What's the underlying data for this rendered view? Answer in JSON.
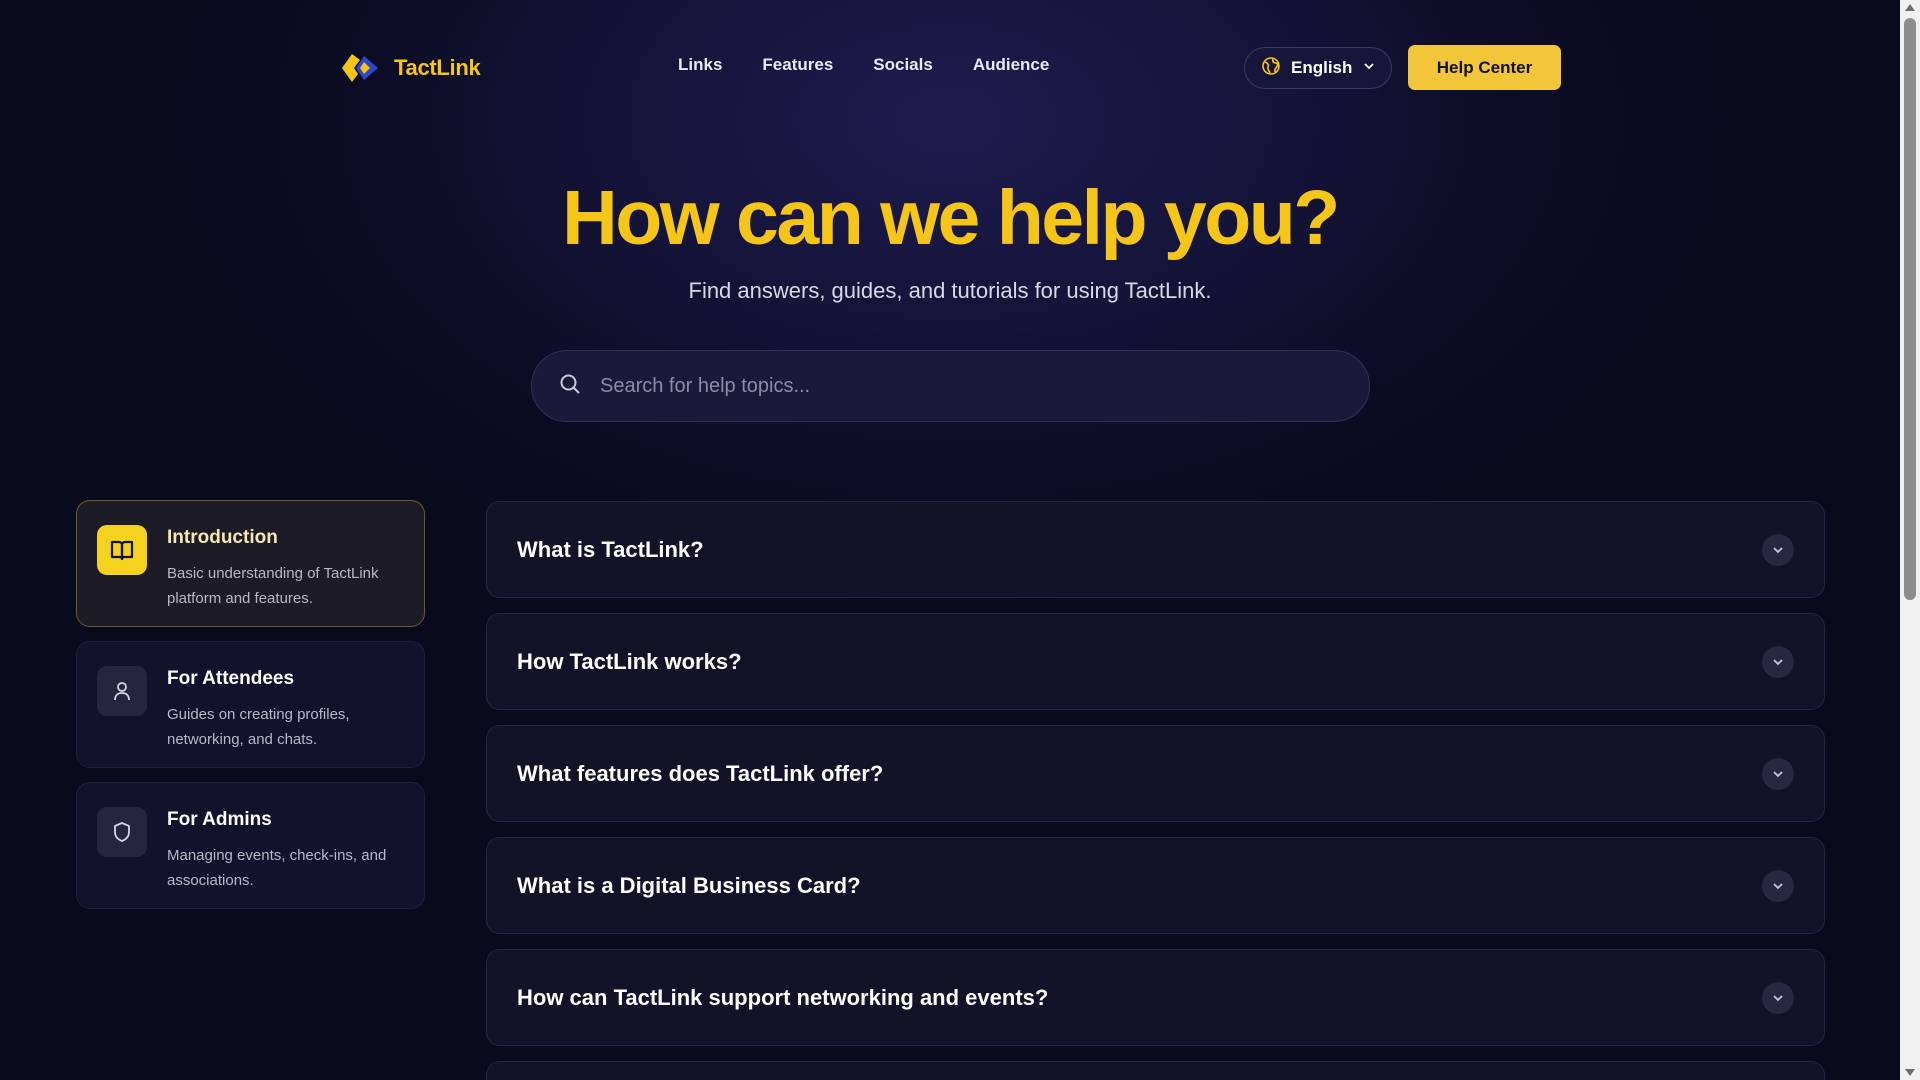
{
  "brand": {
    "name": "TactLink",
    "accent": "#f5c518"
  },
  "nav": {
    "items": [
      "Links",
      "Features",
      "Socials",
      "Audience"
    ]
  },
  "language": {
    "label": "English",
    "icon": "globe-icon"
  },
  "header": {
    "help_label": "Help Center"
  },
  "hero": {
    "title": "How can we help you?",
    "subtitle": "Find answers, guides, and tutorials for using TactLink."
  },
  "search": {
    "placeholder": "Search for help topics...",
    "value": ""
  },
  "sidebar": {
    "items": [
      {
        "title": "Introduction",
        "desc": "Basic understanding of TactLink platform and features.",
        "icon": "book-icon",
        "active": true
      },
      {
        "title": "For Attendees",
        "desc": "Guides on creating profiles, networking, and chats.",
        "icon": "user-icon",
        "active": false
      },
      {
        "title": "For Admins",
        "desc": "Managing events, check-ins, and associations.",
        "icon": "shield-icon",
        "active": false
      }
    ]
  },
  "faq": {
    "items": [
      "What is TactLink?",
      "How TactLink works?",
      "What features does TactLink offer?",
      "What is a Digital Business Card?",
      "How can TactLink support networking and events?"
    ]
  }
}
